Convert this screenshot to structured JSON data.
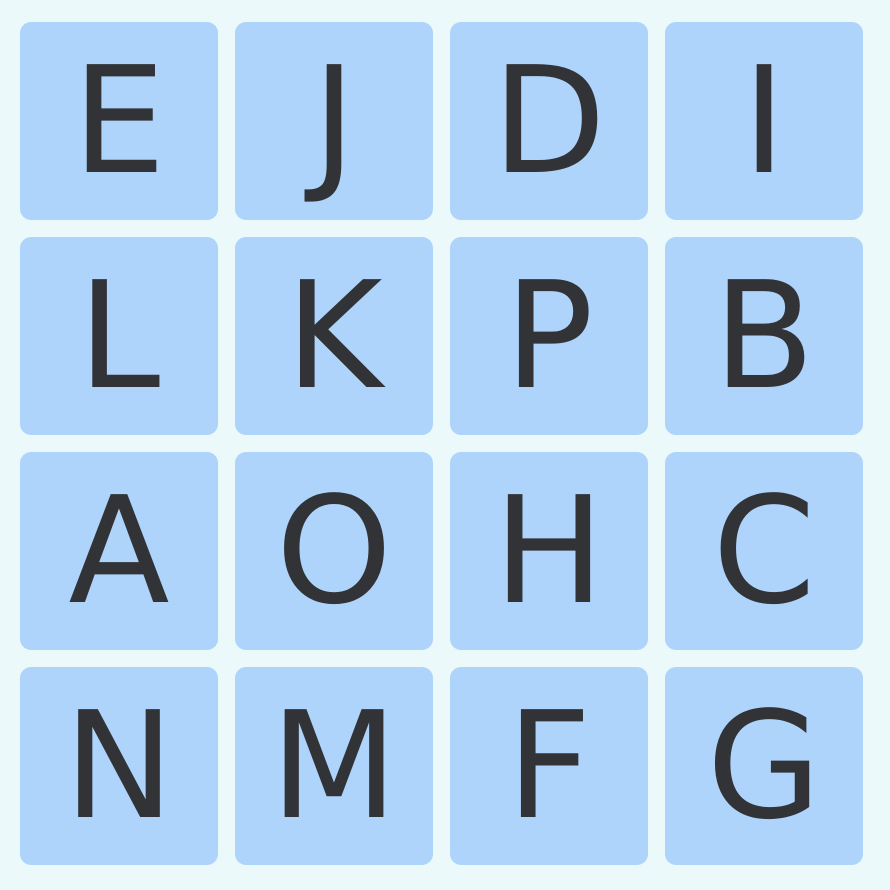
{
  "board": {
    "colors": {
      "background": "#ebf9fb",
      "tile": "#aed4fb",
      "letter": "#323337"
    },
    "rows": [
      [
        "E",
        "J",
        "D",
        "I"
      ],
      [
        "L",
        "K",
        "P",
        "B"
      ],
      [
        "A",
        "O",
        "H",
        "C"
      ],
      [
        "N",
        "M",
        "F",
        "G"
      ]
    ]
  }
}
